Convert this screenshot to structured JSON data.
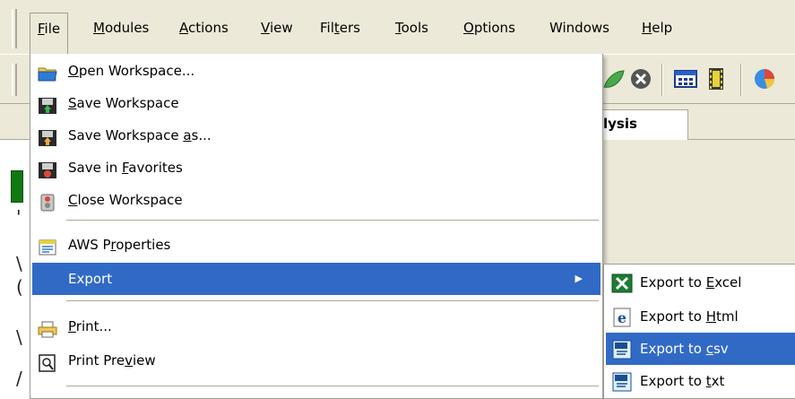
{
  "menubar": {
    "items": [
      {
        "pre": "",
        "key": "F",
        "post": "ile"
      },
      {
        "pre": "",
        "key": "M",
        "post": "odules"
      },
      {
        "pre": "",
        "key": "A",
        "post": "ctions"
      },
      {
        "pre": "",
        "key": "V",
        "post": "iew"
      },
      {
        "pre": "Fil",
        "key": "t",
        "post": "ers"
      },
      {
        "pre": "",
        "key": "T",
        "post": "ools"
      },
      {
        "pre": "",
        "key": "O",
        "post": "ptions"
      },
      {
        "pre": "Windows",
        "key": "",
        "post": ""
      },
      {
        "pre": "",
        "key": "H",
        "post": "elp"
      }
    ]
  },
  "toolbar": {
    "icons": [
      "leaf-icon",
      "stop-icon",
      "calculator-icon",
      "film-icon",
      "pie-chart-icon"
    ]
  },
  "background": {
    "tab_label": "lysis",
    "left_fragments": [
      "'",
      "\\",
      "(",
      "\\",
      "/"
    ]
  },
  "file_menu": {
    "items": [
      {
        "pre": "",
        "key": "O",
        "post": "pen Workspace...",
        "icon": "folder-open-icon"
      },
      {
        "pre": "",
        "key": "S",
        "post": "ave Workspace",
        "icon": "save-workspace-icon"
      },
      {
        "pre": "Save Workspace ",
        "key": "a",
        "post": "s...",
        "icon": "save-as-icon"
      },
      {
        "pre": "Save in ",
        "key": "F",
        "post": "avorites",
        "icon": "favorites-icon"
      },
      {
        "pre": "",
        "key": "C",
        "post": "lose Workspace",
        "icon": "close-workspace-icon"
      },
      {
        "pre": "AWS P",
        "key": "r",
        "post": "operties",
        "icon": "properties-icon"
      },
      {
        "pre": "Export",
        "key": "",
        "post": "",
        "icon": ""
      },
      {
        "pre": "",
        "key": "P",
        "post": "rint...",
        "icon": "printer-icon"
      },
      {
        "pre": "Print Pre",
        "key": "v",
        "post": "iew",
        "icon": "print-preview-icon"
      }
    ],
    "submenu_arrow": "▶"
  },
  "export_submenu": {
    "items": [
      {
        "pre": "Export to ",
        "key": "E",
        "post": "xcel",
        "icon": "excel-icon"
      },
      {
        "pre": "Export to ",
        "key": "H",
        "post": "tml",
        "icon": "ie-html-icon"
      },
      {
        "pre": "Export to ",
        "key": "c",
        "post": "sv",
        "icon": "csv-file-icon"
      },
      {
        "pre": "Export to ",
        "key": "t",
        "post": "xt",
        "icon": "txt-file-icon"
      }
    ]
  },
  "colors": {
    "highlight": "#316ac5",
    "menu_bg": "#ece9d8"
  }
}
